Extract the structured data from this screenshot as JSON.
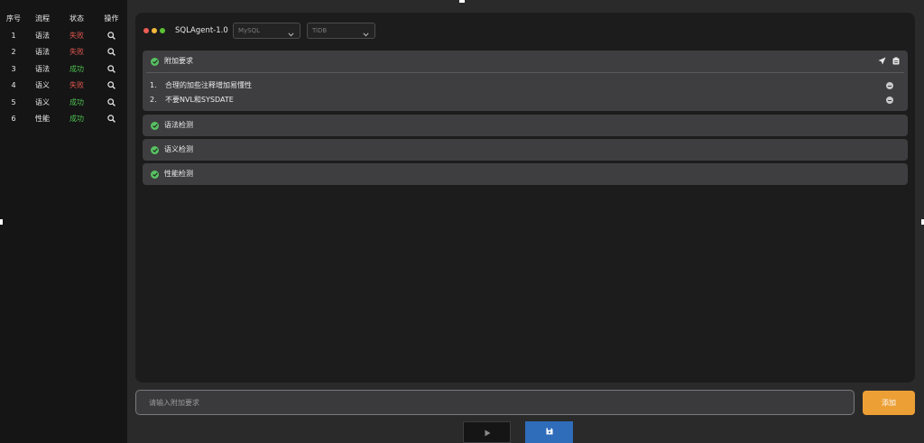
{
  "colors": {
    "fail": "#e4584f",
    "success": "#4fc24f",
    "accent_add": "#ec9f35",
    "accent_save": "#2f6cba",
    "check": "#58c162"
  },
  "flow_table": {
    "headers": {
      "no": "序号",
      "flow": "流程",
      "status": "状态",
      "op": "操作"
    },
    "rows": [
      {
        "no": "1",
        "flow": "语法",
        "status": "失败",
        "state": "fail",
        "op_icon": "search-icon"
      },
      {
        "no": "2",
        "flow": "语法",
        "status": "失败",
        "state": "fail",
        "op_icon": "search-icon"
      },
      {
        "no": "3",
        "flow": "语法",
        "status": "成功",
        "state": "success",
        "op_icon": "search-icon"
      },
      {
        "no": "4",
        "flow": "语义",
        "status": "失败",
        "state": "fail",
        "op_icon": "search-icon"
      },
      {
        "no": "5",
        "flow": "语义",
        "status": "成功",
        "state": "success",
        "op_icon": "search-icon"
      },
      {
        "no": "6",
        "flow": "性能",
        "status": "成功",
        "state": "success",
        "op_icon": "search-icon"
      }
    ]
  },
  "window": {
    "title": "SQLAgent-1.0",
    "source_db": "MySQL",
    "target_db": "TiDB"
  },
  "sections": {
    "requirements": {
      "label": "附加要求",
      "items": [
        {
          "num": "1.",
          "text": "合理的加些注释增加易懂性"
        },
        {
          "num": "2.",
          "text": "不要NVL和SYSDATE"
        }
      ]
    },
    "syntax": {
      "label": "语法检测"
    },
    "semantic": {
      "label": "语义检测"
    },
    "performance": {
      "label": "性能检测"
    }
  },
  "input": {
    "placeholder": "请输入附加要求",
    "value": ""
  },
  "buttons": {
    "add": "添加",
    "run_icon": "play-icon",
    "save_icon": "save-icon"
  }
}
